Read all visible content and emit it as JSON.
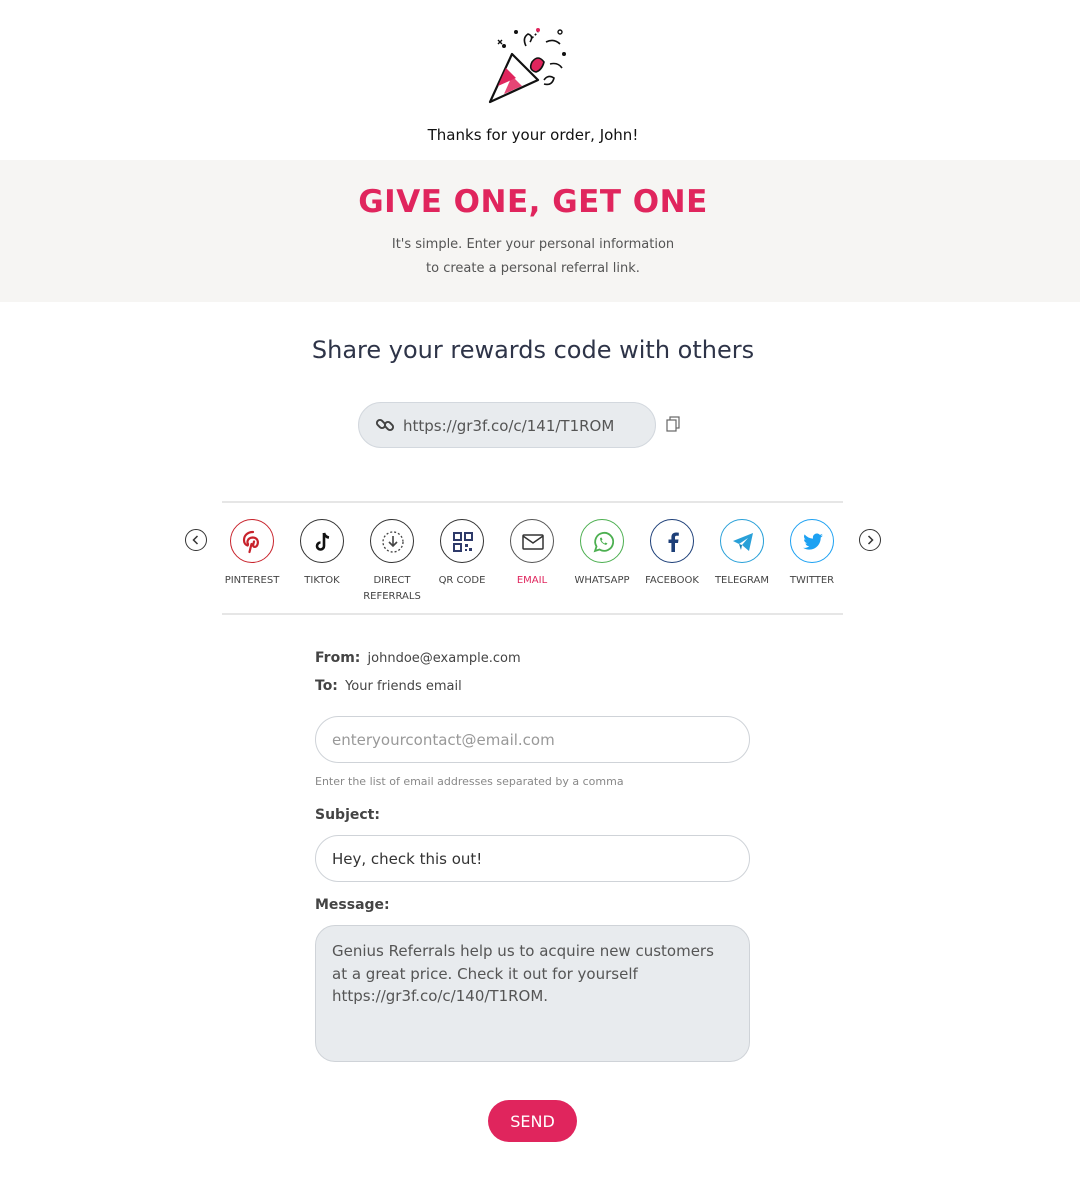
{
  "header": {
    "icon": "party-popper-icon",
    "thanks_text": "Thanks for your order, John!"
  },
  "promo": {
    "title": "GIVE ONE, GET ONE",
    "line1": "It's simple. Enter your personal information",
    "line2": "to create a personal referral link."
  },
  "share": {
    "title": "Share your rewards code with others",
    "link": "https://gr3f.co/c/141/T1ROM",
    "link_icon": "link-icon",
    "copy_icon": "copy-icon"
  },
  "channels": [
    {
      "key": "pinterest",
      "label": "PINTEREST",
      "color": "#c8232c"
    },
    {
      "key": "tiktok",
      "label": "TIKTOK",
      "color": "#111111"
    },
    {
      "key": "direct",
      "label": "DIRECT",
      "label2": "REFERRALS",
      "color": "#333333"
    },
    {
      "key": "qr",
      "label": "QR CODE",
      "color": "#333333"
    },
    {
      "key": "email",
      "label": "EMAIL",
      "color": "#333333"
    },
    {
      "key": "whatsapp",
      "label": "WHATSAPP",
      "color": "#4caf50"
    },
    {
      "key": "facebook",
      "label": "FACEBOOK",
      "color": "#1d3f78"
    },
    {
      "key": "telegram",
      "label": "TELEGRAM",
      "color": "#29a0d8"
    },
    {
      "key": "twitter",
      "label": "TWITTER",
      "color": "#1da1f2"
    }
  ],
  "active_channel": "email",
  "email_form": {
    "from_label": "From:",
    "from_value": "johndoe@example.com",
    "to_label": "To:",
    "to_value": "Your friends email",
    "to_placeholder": "enteryourcontact@email.com",
    "hint": "Enter the list of email addresses separated by a comma",
    "subject_label": "Subject:",
    "subject_value": "Hey, check this out!",
    "message_label": "Message:",
    "message_value": "Genius Referrals help us to acquire new customers at a great price. Check it out for yourself https://gr3f.co/c/140/T1ROM.",
    "send_label": "SEND"
  },
  "colors": {
    "accent": "#e0255d",
    "band_bg": "#f6f5f3",
    "field_bg": "#e8ebee"
  }
}
